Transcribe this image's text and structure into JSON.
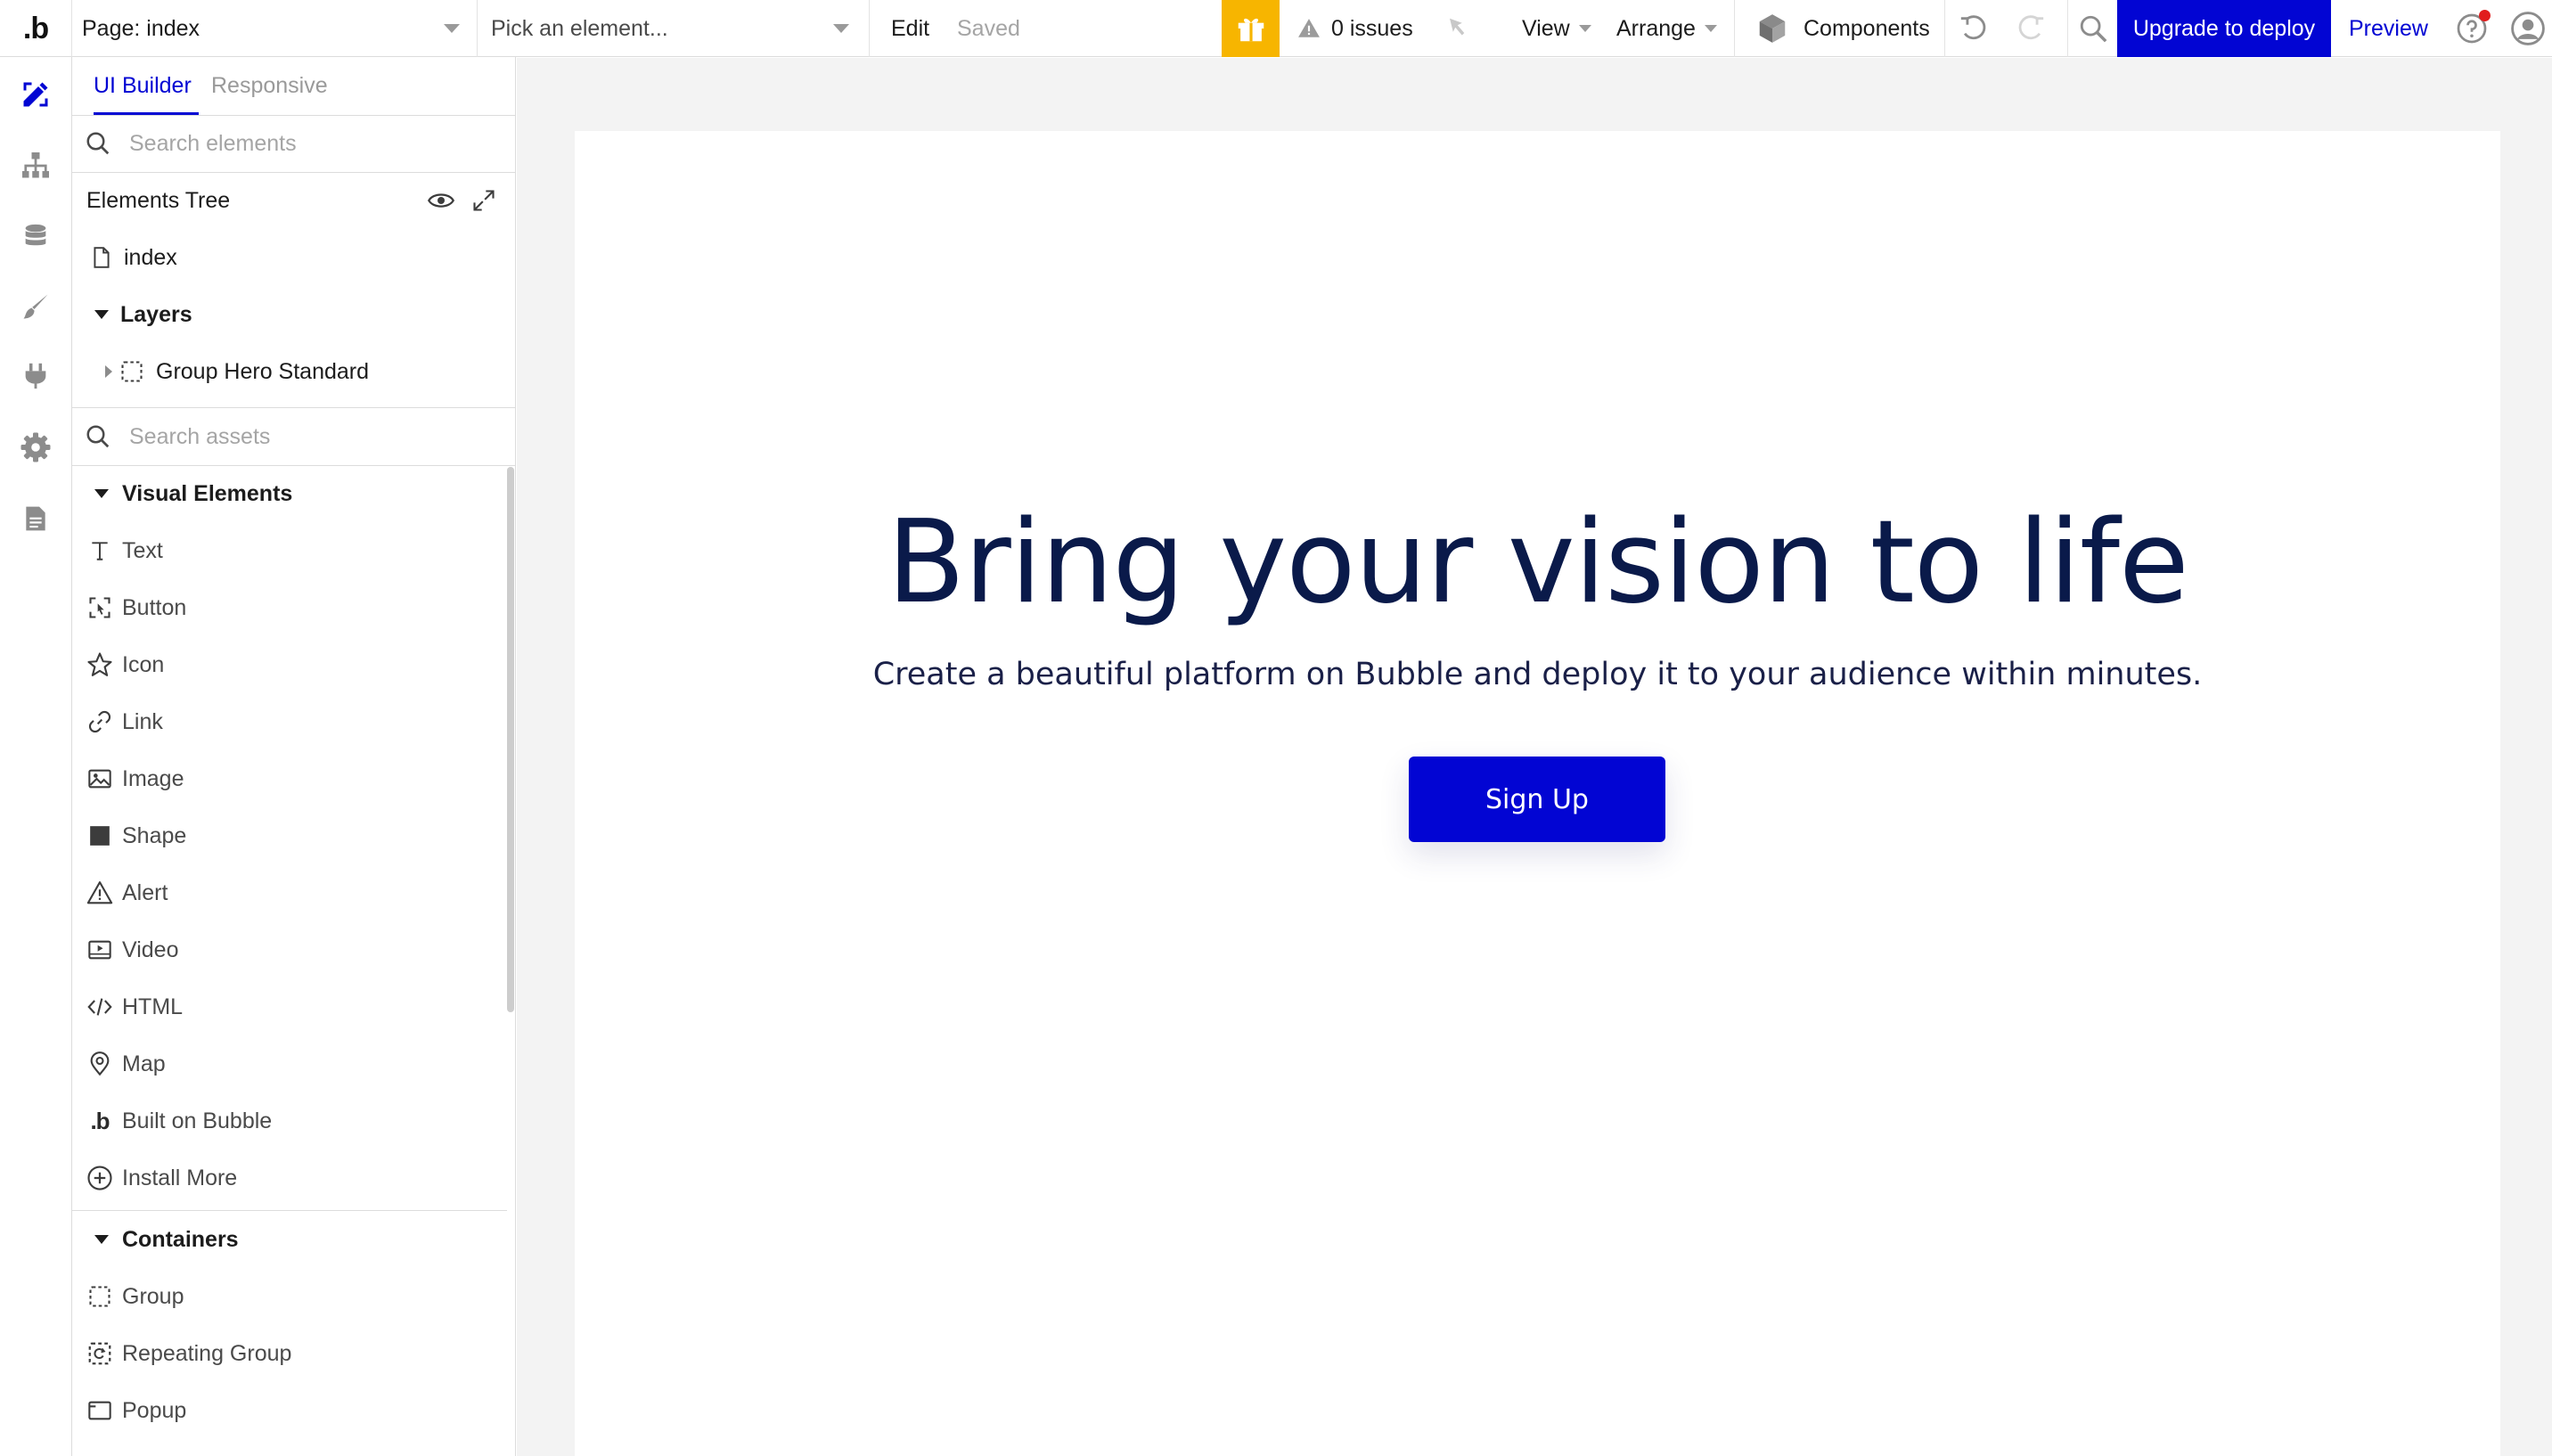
{
  "topbar": {
    "logo": ".b",
    "page_label": "Page: index",
    "element_picker_placeholder": "Pick an element...",
    "edit_label": "Edit",
    "saved_label": "Saved",
    "issues_label": "0 issues",
    "view_label": "View",
    "arrange_label": "Arrange",
    "components_label": "Components",
    "upgrade_label": "Upgrade to deploy",
    "preview_label": "Preview",
    "colors": {
      "gift_bg": "#f7b500",
      "upgrade_bg": "#0205d3",
      "preview_text": "#0205d3",
      "notification_dot": "#e11d1d"
    }
  },
  "leftnav": {
    "items": [
      {
        "icon": "design-icon",
        "active": true
      },
      {
        "icon": "workflow-icon",
        "active": false
      },
      {
        "icon": "data-icon",
        "active": false
      },
      {
        "icon": "styles-icon",
        "active": false
      },
      {
        "icon": "plugins-icon",
        "active": false
      },
      {
        "icon": "settings-icon",
        "active": false
      },
      {
        "icon": "logs-icon",
        "active": false
      }
    ]
  },
  "panel": {
    "tabs": [
      {
        "label": "UI Builder",
        "active": true
      },
      {
        "label": "Responsive",
        "active": false
      }
    ],
    "search_elements_placeholder": "Search elements",
    "elements_tree_title": "Elements Tree",
    "tree": {
      "page": "index",
      "layers_label": "Layers",
      "group": "Group Hero Standard"
    },
    "search_assets_placeholder": "Search assets",
    "visual_elements": {
      "title": "Visual Elements",
      "items": [
        "Text",
        "Button",
        "Icon",
        "Link",
        "Image",
        "Shape",
        "Alert",
        "Video",
        "HTML",
        "Map",
        "Built on Bubble",
        "Install More"
      ]
    },
    "containers": {
      "title": "Containers",
      "items": [
        "Group",
        "Repeating Group",
        "Popup"
      ]
    }
  },
  "canvas": {
    "hero_title": "Bring your vision to life",
    "hero_subtitle": "Create a beautiful platform on Bubble and deploy it to your audience within minutes.",
    "cta_label": "Sign Up",
    "colors": {
      "title": "#0a1a4a",
      "button": "#0205d3",
      "canvas_bg": "#f3f3f3"
    }
  }
}
